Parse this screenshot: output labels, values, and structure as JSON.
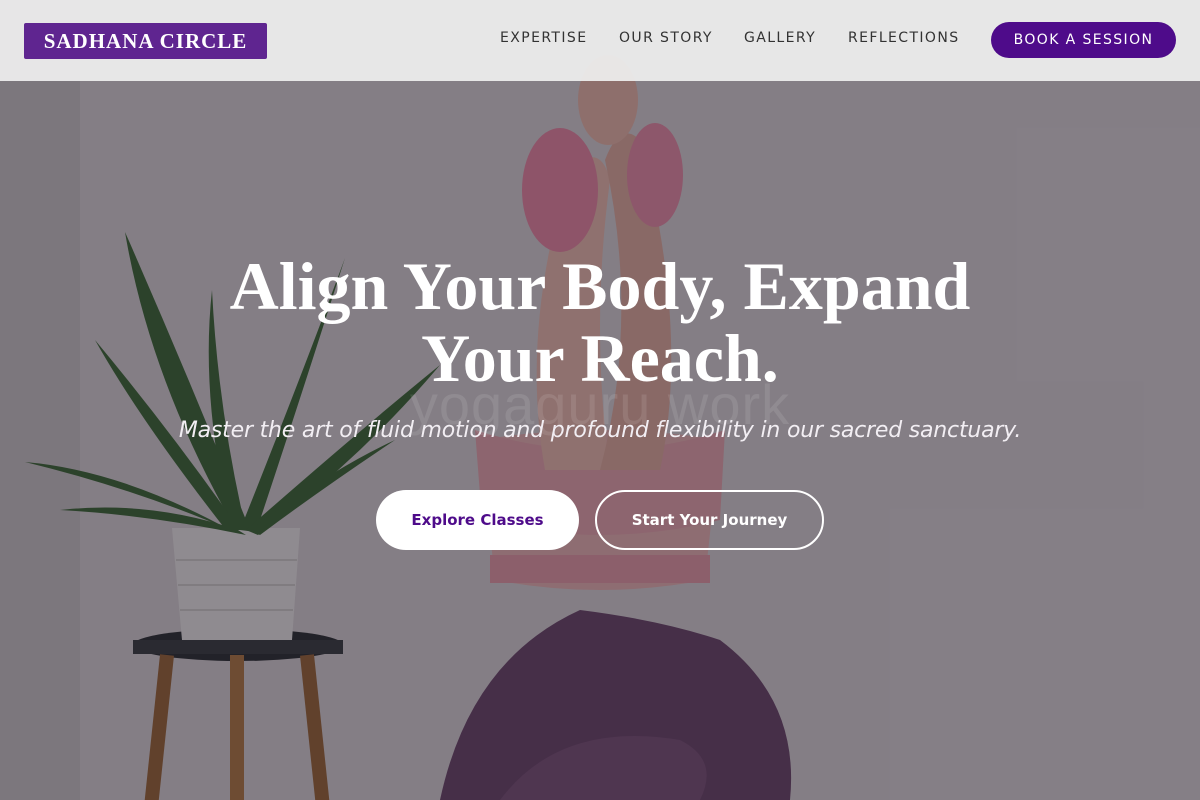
{
  "brand": {
    "name": "SADHANA CIRCLE",
    "color": "#5f2590"
  },
  "nav": {
    "items": [
      {
        "label": "EXPERTISE"
      },
      {
        "label": "OUR STORY"
      },
      {
        "label": "GALLERY"
      },
      {
        "label": "REFLECTIONS"
      }
    ],
    "cta_label": "BOOK A SESSION",
    "cta_color": "#4e0b8a"
  },
  "hero": {
    "headline_line1": "Align Your Body, Expand",
    "headline_line2": "Your Reach.",
    "subheadline": "Master the art of fluid motion and profound flexibility in our sacred sanctuary.",
    "watermark": "yogaguru work",
    "primary_button": "Explore Classes",
    "secondary_button": "Start Your Journey",
    "background_image": "woman-yoga-pose-with-aloe-plant"
  }
}
